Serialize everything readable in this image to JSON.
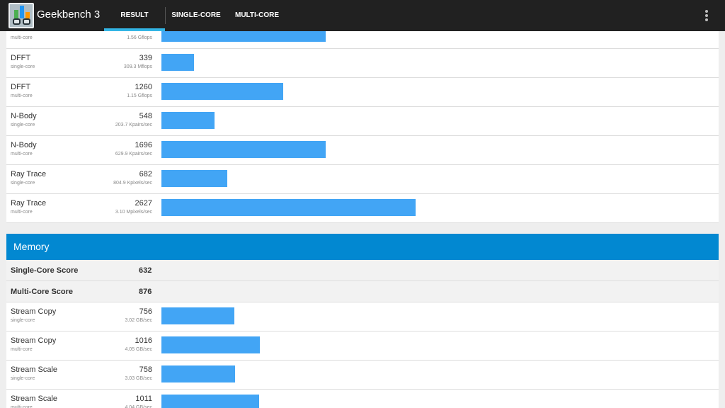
{
  "app": {
    "title": "Geekbench 3"
  },
  "tabs": {
    "result": "RESULT",
    "single_core": "SINGLE-CORE",
    "multi_core": "MULTI-CORE"
  },
  "colors": {
    "appbar": "#212121",
    "tab_indicator": "#33b5e5",
    "section_header": "#0288d1",
    "bar": "#42a5f5"
  },
  "floating_point": {
    "rows": [
      {
        "name": "",
        "sub": "multi-core",
        "score": "",
        "unit": "1.56 Gflops",
        "value": 1700
      },
      {
        "name": "DFFT",
        "sub": "single-core",
        "score": "339",
        "unit": "309.3 Mflops",
        "value": 339
      },
      {
        "name": "DFFT",
        "sub": "multi-core",
        "score": "1260",
        "unit": "1.15 Gflops",
        "value": 1260
      },
      {
        "name": "N-Body",
        "sub": "single-core",
        "score": "548",
        "unit": "203.7 Kpairs/sec",
        "value": 548
      },
      {
        "name": "N-Body",
        "sub": "multi-core",
        "score": "1696",
        "unit": "629.9 Kpairs/sec",
        "value": 1696
      },
      {
        "name": "Ray Trace",
        "sub": "single-core",
        "score": "682",
        "unit": "804.9 Kpixels/sec",
        "value": 682
      },
      {
        "name": "Ray Trace",
        "sub": "multi-core",
        "score": "2627",
        "unit": "3.10 Mpixels/sec",
        "value": 2627
      }
    ]
  },
  "memory": {
    "title": "Memory",
    "single_core_label": "Single-Core Score",
    "single_core_score": "632",
    "multi_core_label": "Multi-Core Score",
    "multi_core_score": "876",
    "rows": [
      {
        "name": "Stream Copy",
        "sub": "single-core",
        "score": "756",
        "unit": "3.02 GB/sec",
        "value": 756
      },
      {
        "name": "Stream Copy",
        "sub": "multi-core",
        "score": "1016",
        "unit": "4.05 GB/sec",
        "value": 1016
      },
      {
        "name": "Stream Scale",
        "sub": "single-core",
        "score": "758",
        "unit": "3.03 GB/sec",
        "value": 758
      },
      {
        "name": "Stream Scale",
        "sub": "multi-core",
        "score": "1011",
        "unit": "4.04 GB/sec",
        "value": 1011
      }
    ]
  }
}
